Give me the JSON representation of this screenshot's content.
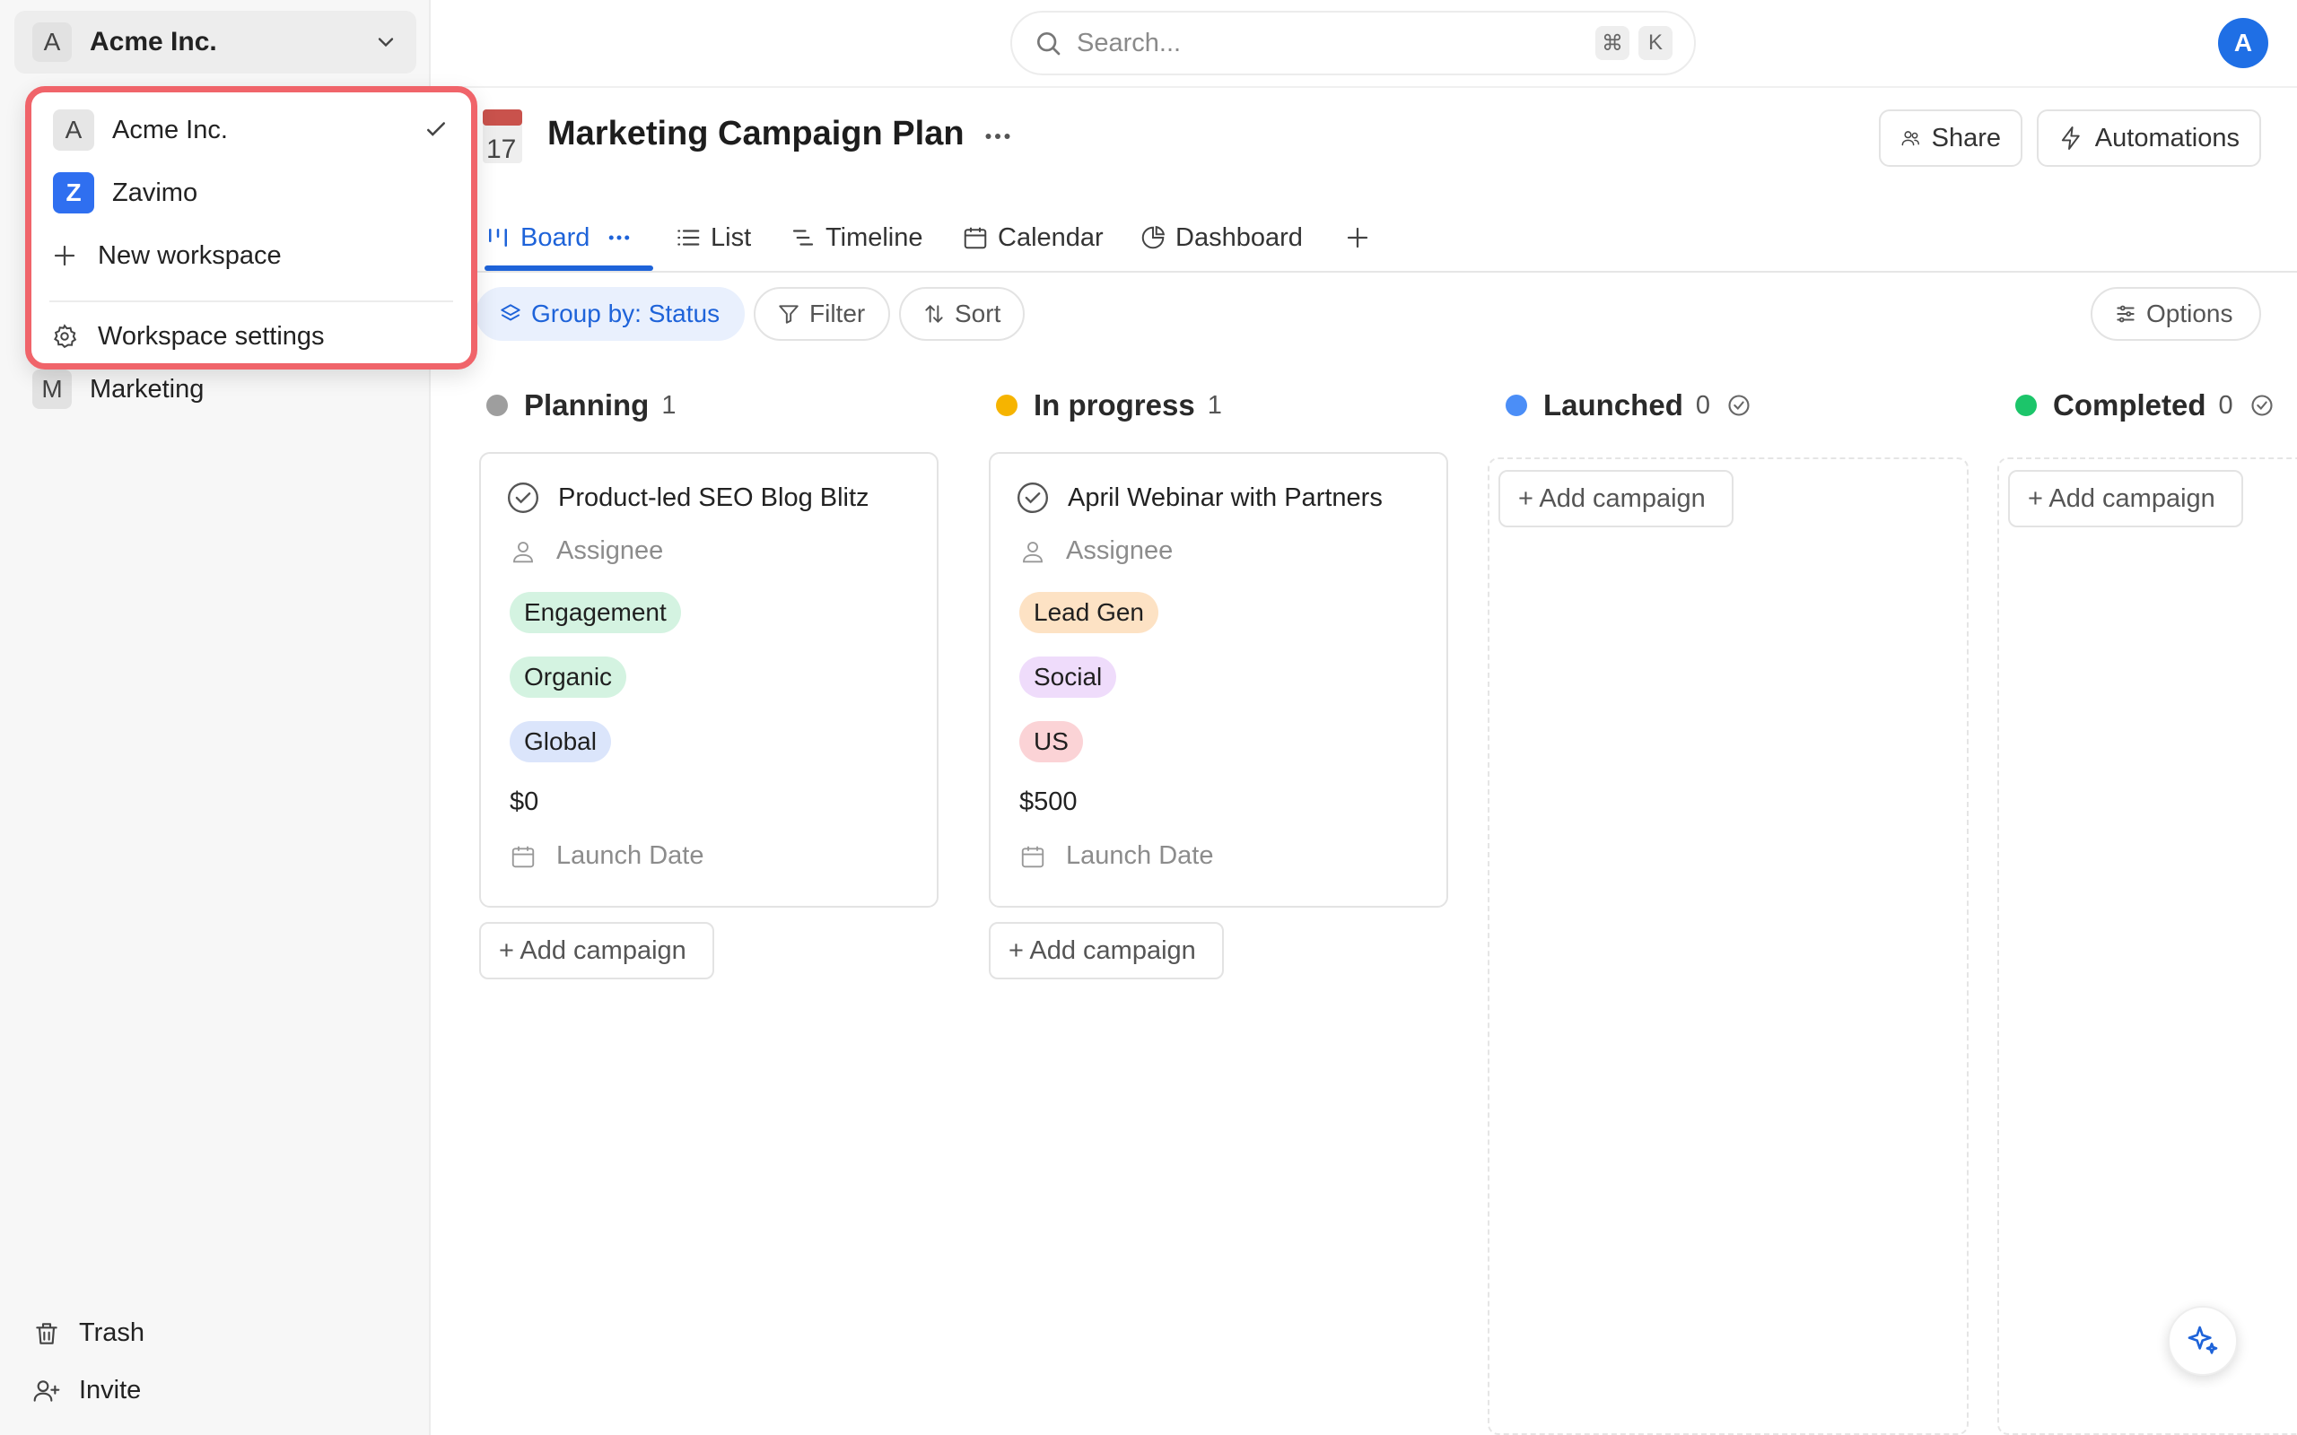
{
  "workspace": {
    "current": "Acme Inc.",
    "avatar_letter": "A"
  },
  "dropdown": {
    "items": [
      {
        "avatar": "A",
        "label": "Acme Inc.",
        "selected": true
      },
      {
        "avatar": "Z",
        "label": "Zavimo",
        "selected": false
      }
    ],
    "new_workspace": "New workspace",
    "settings": "Workspace settings"
  },
  "sidebar": {
    "marketing": {
      "avatar": "M",
      "label": "Marketing"
    },
    "trash": "Trash",
    "invite": "Invite"
  },
  "search": {
    "placeholder": "Search...",
    "shortcut_1": "⌘",
    "shortcut_2": "K"
  },
  "user": {
    "avatar_letter": "A"
  },
  "page": {
    "calendar_day": "17",
    "title": "Marketing Campaign Plan"
  },
  "header_buttons": {
    "share": "Share",
    "automations": "Automations"
  },
  "tabs": {
    "board": "Board",
    "list": "List",
    "timeline": "Timeline",
    "calendar": "Calendar",
    "dashboard": "Dashboard"
  },
  "toolbar": {
    "group_by": "Group by: Status",
    "filter": "Filter",
    "sort": "Sort",
    "options": "Options"
  },
  "columns": [
    {
      "name": "Planning",
      "count": "1",
      "color": "#9e9e9e"
    },
    {
      "name": "In progress",
      "count": "1",
      "color": "#f6b400"
    },
    {
      "name": "Launched",
      "count": "0",
      "color": "#4b8ef7"
    },
    {
      "name": "Completed",
      "count": "0",
      "color": "#1cc56a"
    }
  ],
  "cards": [
    {
      "title": "Product-led SEO Blog Blitz",
      "assignee": "Assignee",
      "tags": [
        {
          "label": "Engagement",
          "color": "#d4f3e1"
        },
        {
          "label": "Organic",
          "color": "#d4f3e1"
        },
        {
          "label": "Global",
          "color": "#dbe5fb"
        }
      ],
      "amount": "$0",
      "launch_date": "Launch Date"
    },
    {
      "title": "April Webinar with Partners",
      "assignee": "Assignee",
      "tags": [
        {
          "label": "Lead Gen",
          "color": "#fde2c4"
        },
        {
          "label": "Social",
          "color": "#efdcfb"
        },
        {
          "label": "US",
          "color": "#fbd3d6"
        }
      ],
      "amount": "$500",
      "launch_date": "Launch Date"
    }
  ],
  "add_campaign": "+ Add campaign",
  "colors": {
    "accent": "#1e63d9",
    "highlight_border": "#f0646a"
  }
}
